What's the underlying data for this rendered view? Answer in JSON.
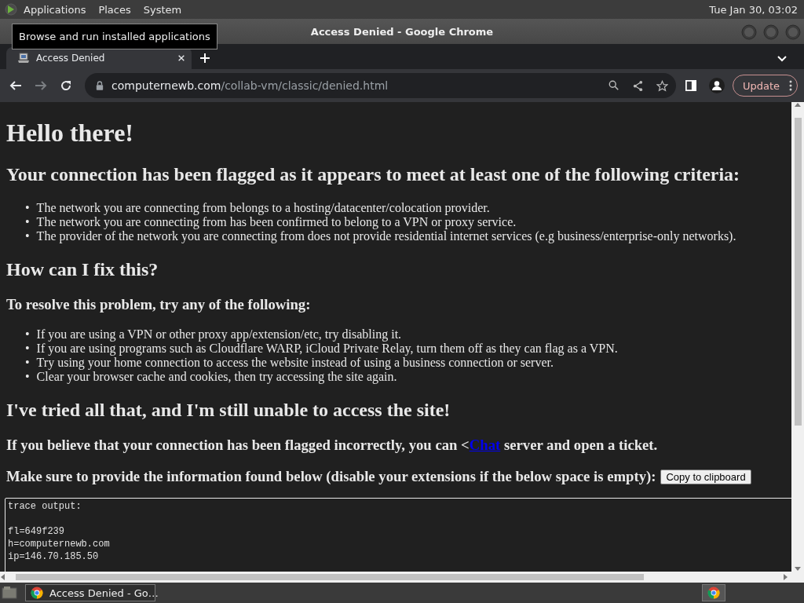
{
  "top_panel": {
    "menus": [
      "Applications",
      "Places",
      "System"
    ],
    "clock": "Tue Jan 30, 03:02"
  },
  "tooltip": "Browse and run installed applications",
  "window": {
    "title": "Access Denied - Google Chrome"
  },
  "tabs": [
    {
      "label": "Access Denied",
      "selected": true
    }
  ],
  "address_bar": {
    "domain": "computernewb.com",
    "path": "/collab-vm/classic/denied.html"
  },
  "update_button": "Update",
  "page": {
    "title": "Hello there!",
    "bullet": "•",
    "criteria_heading": "Your connection has been flagged as it appears to meet at least one of the following criteria:",
    "criteria": [
      "The network you are connecting from belongs to a hosting/datacenter/colocation provider.",
      "The network you are connecting from has been confirmed to belong to a VPN or proxy service.",
      "The provider of the network you are connecting from does not provide residential internet services (e.g business/enterprise-only networks)."
    ],
    "fix_heading": "How can I fix this?",
    "fix_intro": "To resolve this problem, try any of the following:",
    "fixes": [
      "If you are using a VPN or other proxy app/extension/etc, try disabling it.",
      "If you are using programs such as Cloudflare WARP, iCloud Private Relay, turn them off as they can flag as a VPN.",
      "Try using your home connection to access the website instead of using a business connection or server.",
      "Clear your browser cache and cookies, then try accessing the site again."
    ],
    "tried_heading": "I've tried all that, and I'm still unable to access the site!",
    "incorrect_note": {
      "before": "If you believe that your connection has been flagged incorrectly, you can <",
      "link": "Chat",
      "after": " server and open a ticket."
    },
    "info_note": "Make sure to provide the information found below (disable your extensions if the below space is empty):",
    "copy_button": "Copy to clipboard",
    "trace": {
      "heading": "trace output:",
      "lines": [
        "fl=649f239",
        "h=computernewb.com",
        "ip=146.70.185.50"
      ]
    }
  },
  "taskbar": {
    "items": [
      {
        "label": "Access Denied - Go…",
        "selected": true
      }
    ]
  }
}
